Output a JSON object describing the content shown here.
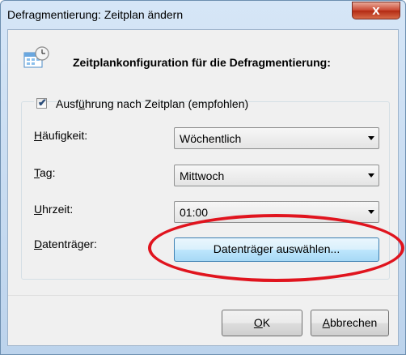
{
  "window": {
    "title": "Defragmentierung: Zeitplan ändern",
    "close_label": "x"
  },
  "header": {
    "icon": "calendar-clock-icon",
    "text": "Zeitplankonfiguration für die Defragmentierung:"
  },
  "schedule": {
    "run_label_pre": "Ausf",
    "run_label_mnemonic": "ü",
    "run_label_post": "hrung nach Zeitplan (empfohlen)",
    "run_checked": true
  },
  "fields": {
    "frequency": {
      "label_mnemonic": "H",
      "label_rest": "äufigkeit:",
      "value": "Wöchentlich"
    },
    "day": {
      "label_mnemonic": "T",
      "label_rest": "ag:",
      "value": "Mittwoch"
    },
    "time": {
      "label_mnemonic": "U",
      "label_rest": "hrzeit:",
      "value": "01:00"
    },
    "drives": {
      "label_mnemonic": "D",
      "label_rest": "atenträger:",
      "button": "Datenträger auswählen..."
    }
  },
  "footer": {
    "ok_mnemonic": "O",
    "ok_rest": "K",
    "cancel_mnemonic": "A",
    "cancel_rest": "bbrechen"
  },
  "colors": {
    "annotation": "#e0141e",
    "accent": "#3c7fb1"
  }
}
